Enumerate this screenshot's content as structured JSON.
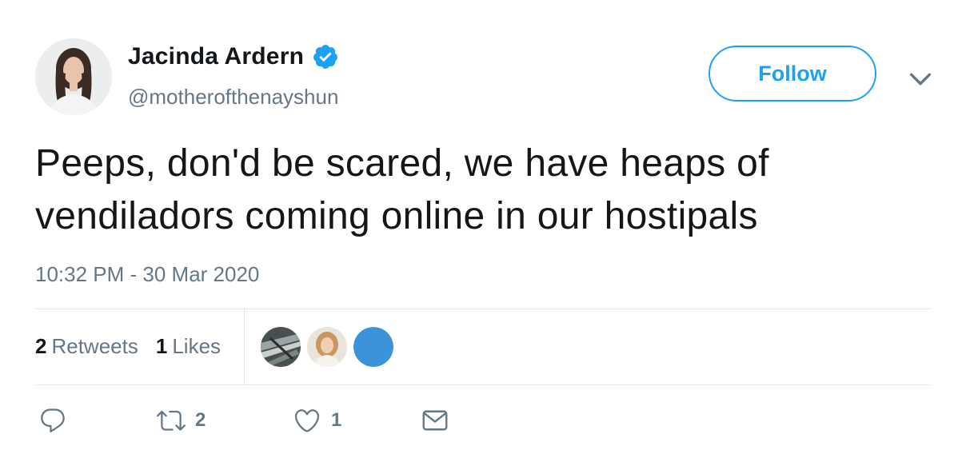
{
  "author": {
    "display_name": "Jacinda Ardern",
    "handle": "@motherofthenayshun",
    "verified_icon": "verified-badge-icon",
    "verified_color": "#1da1f2"
  },
  "header": {
    "follow_label": "Follow",
    "more_icon": "chevron-down-icon"
  },
  "tweet": {
    "text": "Peeps, don'd be scared, we have heaps of vendiladors coming online in our hostipals",
    "timestamp": "10:32 PM - 30 Mar 2020"
  },
  "stats": {
    "retweets_count": "2",
    "retweets_label": "Retweets",
    "likes_count": "1",
    "likes_label": "Likes"
  },
  "likers": [
    {
      "icon": "liker-avatar-1"
    },
    {
      "icon": "liker-avatar-2"
    },
    {
      "icon": "liker-avatar-3",
      "color": "#3b94d9"
    }
  ],
  "actions": {
    "reply_icon": "reply-icon",
    "retweet_icon": "retweet-icon",
    "retweet_count": "2",
    "like_icon": "heart-icon",
    "like_count": "1",
    "dm_icon": "envelope-icon"
  },
  "colors": {
    "accent": "#1da1f2",
    "text_primary": "#14171a",
    "text_secondary": "#657786",
    "divider": "#e1e8ed"
  }
}
